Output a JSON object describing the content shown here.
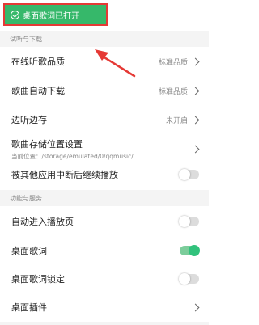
{
  "toast": {
    "text": "桌面歌词已打开",
    "icon": "check-circle-icon"
  },
  "sections": {
    "listen_download": "试听与下载",
    "features_services": "功能与服务"
  },
  "items": {
    "online_quality": {
      "label": "在线听歌品质",
      "value": "标准品质"
    },
    "auto_download": {
      "label": "歌曲自动下载",
      "value": "标准品质"
    },
    "play_while_cache": {
      "label": "边听边存",
      "value": "未开启"
    },
    "storage_location": {
      "label": "歌曲存储位置设置",
      "sub": "当前位置：/storage/emulated/0/qqmusic/"
    },
    "resume_after_interrupt": {
      "label": "被其他应用中断后继续播放",
      "on": false
    },
    "auto_enter_player": {
      "label": "自动进入播放页",
      "on": false
    },
    "desktop_lyrics": {
      "label": "桌面歌词",
      "on": true
    },
    "desktop_lyrics_lock": {
      "label": "桌面歌词锁定",
      "on": false
    },
    "desktop_widget": {
      "label": "桌面插件"
    }
  },
  "colors": {
    "accent_green": "#31c27c",
    "highlight_red": "#e53935",
    "toast_bg": "#36b86a"
  }
}
